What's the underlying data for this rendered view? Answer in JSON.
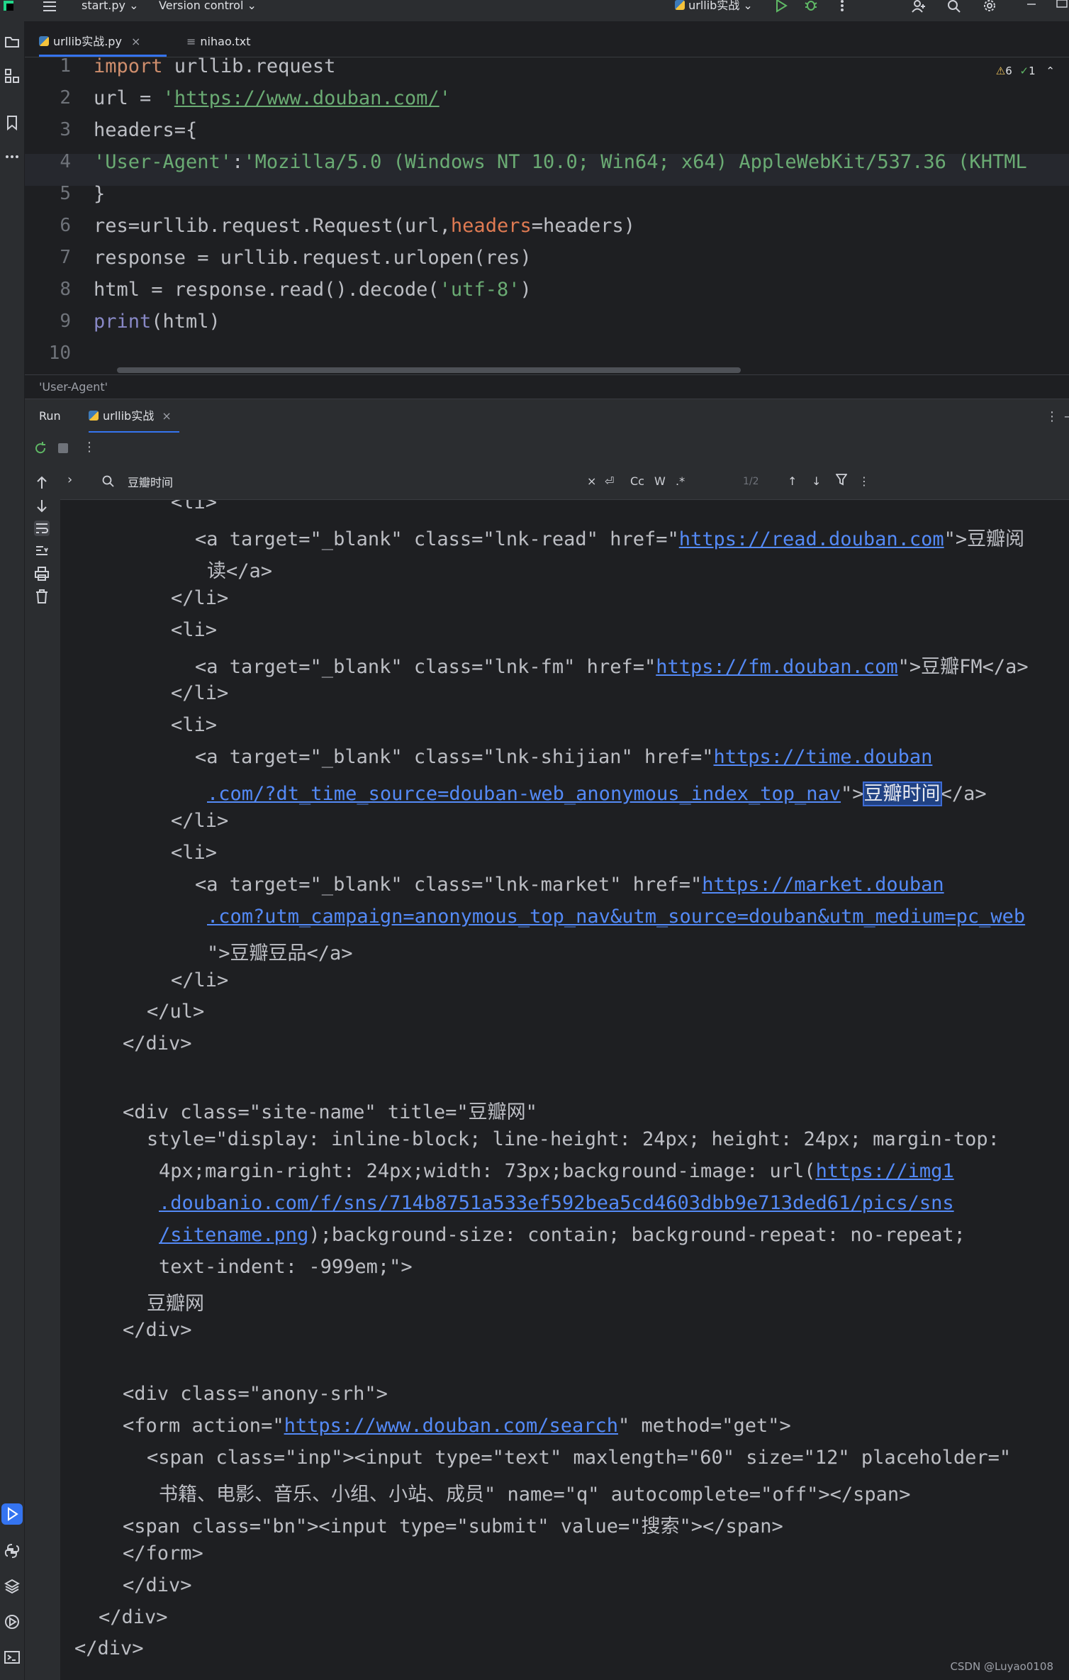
{
  "titlebar": {
    "project": "start.py",
    "vcs": "Version control",
    "run_config": "urllib实战"
  },
  "editor": {
    "tabs": [
      {
        "label": "urllib实战.py",
        "active": true
      },
      {
        "label": "nihao.txt",
        "active": false
      }
    ],
    "inspections": {
      "warnings": "6",
      "ok": "1"
    },
    "lines": [
      {
        "n": "1",
        "segs": [
          {
            "t": "import",
            "c": "kw"
          },
          {
            "t": " urllib.request"
          }
        ]
      },
      {
        "n": "2",
        "segs": [
          {
            "t": "url = "
          },
          {
            "t": "'",
            "c": "str"
          },
          {
            "t": "https://www.douban.com/",
            "c": "str ul"
          },
          {
            "t": "'",
            "c": "str"
          }
        ]
      },
      {
        "n": "3",
        "segs": [
          {
            "t": "headers={"
          }
        ]
      },
      {
        "n": "4",
        "segs": [
          {
            "t": "'User-Agent'",
            "c": "str"
          },
          {
            "t": ":"
          },
          {
            "t": "'Mozilla/5.0 (Windows NT 10.0; Win64; x64) AppleWebKit/537.36 (KHTML",
            "c": "str"
          }
        ]
      },
      {
        "n": "5",
        "segs": [
          {
            "t": "}"
          }
        ]
      },
      {
        "n": "6",
        "segs": [
          {
            "t": "res=urllib.request.Request(url,"
          },
          {
            "t": "headers",
            "c": "param"
          },
          {
            "t": "=headers)"
          }
        ]
      },
      {
        "n": "7",
        "segs": [
          {
            "t": "response = urllib.request.urlopen(res)"
          }
        ]
      },
      {
        "n": "8",
        "segs": [
          {
            "t": "html = response.read().decode("
          },
          {
            "t": "'utf-8'",
            "c": "str"
          },
          {
            "t": ")"
          }
        ]
      },
      {
        "n": "9",
        "segs": [
          {
            "t": "print",
            "c": "fn"
          },
          {
            "t": "(html)"
          }
        ]
      },
      {
        "n": "10",
        "segs": []
      }
    ],
    "breadcrumb": "'User-Agent'"
  },
  "run": {
    "tabs": [
      {
        "label": "Run",
        "active": false
      },
      {
        "label": "urllib实战",
        "active": true
      }
    ],
    "search": {
      "value": "豆瓣时间",
      "match_count": "1/2",
      "case_label": "Cc",
      "word_label": "W",
      "regex_label": ".*"
    },
    "output": [
      {
        "i": 4,
        "segs": [
          {
            "t": "<li>"
          }
        ]
      },
      {
        "i": 5,
        "segs": [
          {
            "t": "<a target=\"_blank\" class=\"lnk-read\" href=\""
          },
          {
            "t": "https://read.douban.com",
            "c": "lnk"
          },
          {
            "t": "\">豆瓣阅"
          }
        ]
      },
      {
        "i": 5.5,
        "segs": [
          {
            "t": "读</a>"
          }
        ]
      },
      {
        "i": 4,
        "segs": [
          {
            "t": "</li>"
          }
        ]
      },
      {
        "i": 4,
        "segs": [
          {
            "t": "<li>"
          }
        ]
      },
      {
        "i": 5,
        "segs": [
          {
            "t": "<a target=\"_blank\" class=\"lnk-fm\" href=\""
          },
          {
            "t": "https://fm.douban.com",
            "c": "lnk"
          },
          {
            "t": "\">豆瓣FM</a>"
          }
        ]
      },
      {
        "i": 4,
        "segs": [
          {
            "t": "</li>"
          }
        ]
      },
      {
        "i": 4,
        "segs": [
          {
            "t": "<li>"
          }
        ]
      },
      {
        "i": 5,
        "segs": [
          {
            "t": "<a target=\"_blank\" class=\"lnk-shijian\" href=\""
          },
          {
            "t": "https://time.douban",
            "c": "lnk"
          }
        ]
      },
      {
        "i": 5.5,
        "segs": [
          {
            "t": ".com/?dt_time_source=douban-web_anonymous_index_top_nav",
            "c": "lnk"
          },
          {
            "t": "\">"
          },
          {
            "t": "豆瓣时间",
            "c": "hl"
          },
          {
            "t": "</a>"
          }
        ]
      },
      {
        "i": 4,
        "segs": [
          {
            "t": "</li>"
          }
        ]
      },
      {
        "i": 4,
        "segs": [
          {
            "t": "<li>"
          }
        ]
      },
      {
        "i": 5,
        "segs": [
          {
            "t": "<a target=\"_blank\" class=\"lnk-market\" href=\""
          },
          {
            "t": "https://market.douban",
            "c": "lnk"
          }
        ]
      },
      {
        "i": 5.5,
        "segs": [
          {
            "t": ".com?utm_campaign=anonymous_top_nav&utm_source=douban&utm_medium=pc_web",
            "c": "lnk"
          }
        ]
      },
      {
        "i": 5.5,
        "segs": [
          {
            "t": "\">豆瓣豆品</a>"
          }
        ]
      },
      {
        "i": 4,
        "segs": [
          {
            "t": "</li>"
          }
        ]
      },
      {
        "i": 3,
        "segs": [
          {
            "t": "</ul>"
          }
        ]
      },
      {
        "i": 2,
        "segs": [
          {
            "t": "</div>"
          }
        ]
      },
      {
        "i": 0,
        "segs": []
      },
      {
        "i": 2,
        "segs": [
          {
            "t": "<div class=\"site-name\" title=\"豆瓣网\""
          }
        ]
      },
      {
        "i": 3,
        "segs": [
          {
            "t": "style=\"display: inline-block; line-height: 24px; height: 24px; margin-top:"
          }
        ]
      },
      {
        "i": 3.5,
        "segs": [
          {
            "t": "4px;margin-right: 24px;width: 73px;background-image: url("
          },
          {
            "t": "https://img1",
            "c": "lnk"
          }
        ]
      },
      {
        "i": 3.5,
        "segs": [
          {
            "t": ".doubanio.com/f/sns/714b8751a533ef592bea5cd4603dbb9e713ded61/pics/sns",
            "c": "lnk"
          }
        ]
      },
      {
        "i": 3.5,
        "segs": [
          {
            "t": "/sitename.png",
            "c": "lnk"
          },
          {
            "t": ");background-size: contain; background-repeat: no-repeat;"
          }
        ]
      },
      {
        "i": 3.5,
        "segs": [
          {
            "t": "text-indent: -999em;\">"
          }
        ]
      },
      {
        "i": 3,
        "segs": [
          {
            "t": "豆瓣网"
          }
        ]
      },
      {
        "i": 2,
        "segs": [
          {
            "t": "</div>"
          }
        ]
      },
      {
        "i": 0,
        "segs": []
      },
      {
        "i": 2,
        "segs": [
          {
            "t": "<div class=\"anony-srh\">"
          }
        ]
      },
      {
        "i": 2,
        "segs": [
          {
            "t": "<form action=\""
          },
          {
            "t": "https://www.douban.com/search",
            "c": "lnk"
          },
          {
            "t": "\" method=\"get\">"
          }
        ]
      },
      {
        "i": 3,
        "segs": [
          {
            "t": "<span class=\"inp\"><input type=\"text\" maxlength=\"60\" size=\"12\" placeholder=\""
          }
        ]
      },
      {
        "i": 3.5,
        "segs": [
          {
            "t": "书籍、电影、音乐、小组、小站、成员\" name=\"q\" autocomplete=\"off\"></span>"
          }
        ]
      },
      {
        "i": 2,
        "segs": [
          {
            "t": "<span class=\"bn\"><input type=\"submit\" value=\"搜索\"></span>"
          }
        ]
      },
      {
        "i": 2,
        "segs": [
          {
            "t": "</form>"
          }
        ]
      },
      {
        "i": 2,
        "segs": [
          {
            "t": "</div>"
          }
        ]
      },
      {
        "i": 1,
        "segs": [
          {
            "t": "</div>"
          }
        ]
      },
      {
        "i": 0,
        "segs": [
          {
            "t": "</div>"
          }
        ]
      }
    ]
  },
  "watermark": "CSDN @Luyao0108",
  "colors": {
    "accent": "#3574f0",
    "keyword": "#cf8e6d",
    "string": "#6aab73",
    "link": "#548af7",
    "highlight": "#214283",
    "run_green": "#5fb865"
  }
}
